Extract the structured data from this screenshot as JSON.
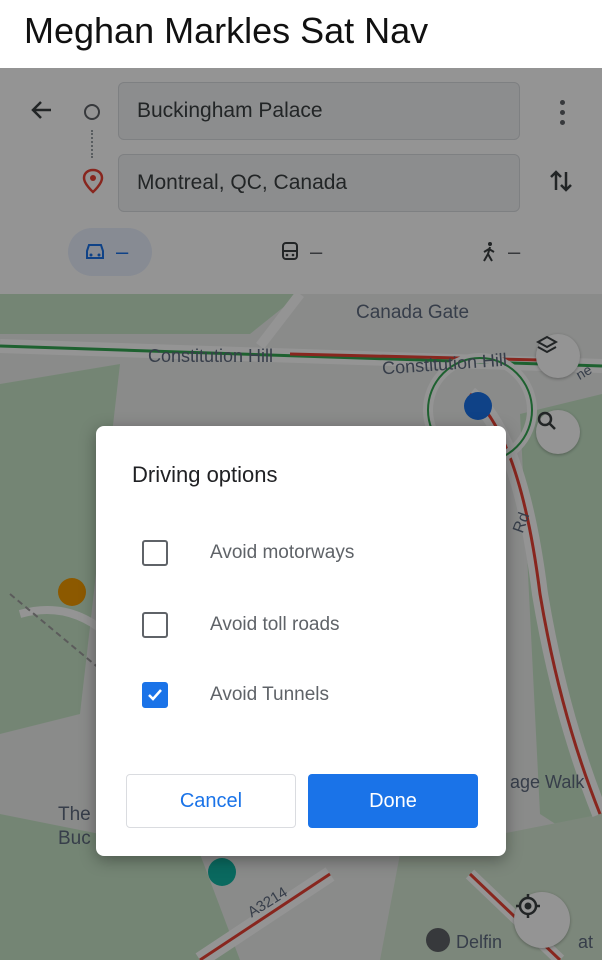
{
  "meme": {
    "title": "Meghan Markles Sat Nav"
  },
  "directions": {
    "origin": "Buckingham Palace",
    "destination": "Montreal, QC, Canada",
    "modes": [
      {
        "name": "drive",
        "value": "–"
      },
      {
        "name": "transit",
        "value": "–"
      },
      {
        "name": "walk",
        "value": "–"
      }
    ]
  },
  "map": {
    "labels": {
      "canada_gate": "Canada Gate",
      "constitution_hill_1": "Constitution Hill",
      "constitution_hill_2": "Constitution Hill",
      "road_rd": "Rd",
      "walk": "age Walk",
      "the": "The",
      "buc": "Buc",
      "a3214": "A3214",
      "delfin": "Delfin",
      "at": "at",
      "ne": "ne"
    }
  },
  "dialog": {
    "title": "Driving options",
    "options": [
      {
        "label": "Avoid motorways",
        "checked": false
      },
      {
        "label": "Avoid toll roads",
        "checked": false
      },
      {
        "label": "Avoid Tunnels",
        "checked": true
      }
    ],
    "cancel_label": "Cancel",
    "done_label": "Done"
  },
  "colors": {
    "accent": "#1a73e8",
    "scrim": "rgba(0,0,0,0.42)"
  },
  "icons": [
    "back-arrow-icon",
    "origin-circle-icon",
    "destination-pin-icon",
    "more-vert-icon",
    "swap-icon",
    "car-icon",
    "transit-icon",
    "walk-icon",
    "layers-icon",
    "search-icon",
    "my-location-icon",
    "checkmark-icon"
  ]
}
